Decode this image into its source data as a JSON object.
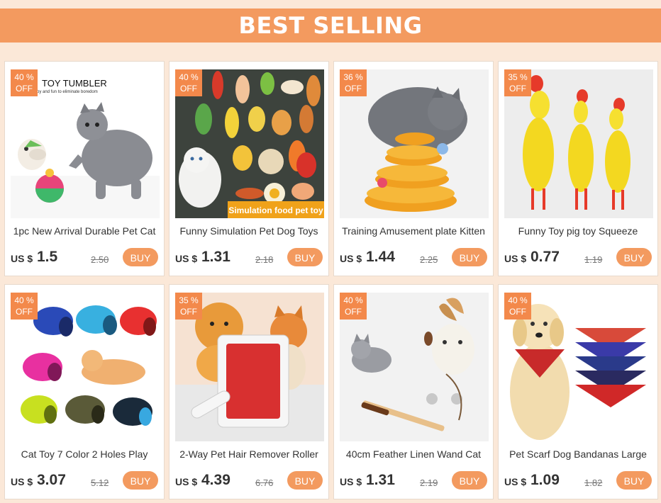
{
  "header": {
    "title": "BEST SELLING"
  },
  "products": [
    {
      "discount": "40 %",
      "off": "OFF",
      "title": "1pc New Arrival Durable Pet Cat",
      "currency": "US $",
      "price": "1.5",
      "old_price": "2.50",
      "buy_label": "BUY",
      "image_caption": "TOY TUMBLER",
      "image_subcaption": "Joy and fun to eliminate boredom"
    },
    {
      "discount": "40 %",
      "off": "OFF",
      "title": "Funny Simulation Pet Dog Toys",
      "currency": "US $",
      "price": "1.31",
      "old_price": "2.18",
      "buy_label": "BUY",
      "image_caption": "Simulation food pet toy"
    },
    {
      "discount": "36 %",
      "off": "OFF",
      "title": "Training Amusement plate Kitten",
      "currency": "US $",
      "price": "1.44",
      "old_price": "2.25",
      "buy_label": "BUY"
    },
    {
      "discount": "35 %",
      "off": "OFF",
      "title": "Funny Toy pig toy Squeeze",
      "currency": "US $",
      "price": "0.77",
      "old_price": "1.19",
      "buy_label": "BUY"
    },
    {
      "discount": "40 %",
      "off": "OFF",
      "title": "Cat Toy 7 Color 2 Holes Play",
      "currency": "US $",
      "price": "3.07",
      "old_price": "5.12",
      "buy_label": "BUY"
    },
    {
      "discount": "35 %",
      "off": "OFF",
      "title": "2-Way Pet Hair Remover Roller",
      "currency": "US $",
      "price": "4.39",
      "old_price": "6.76",
      "buy_label": "BUY"
    },
    {
      "discount": "40 %",
      "off": "OFF",
      "title": "40cm  Feather Linen Wand Cat",
      "currency": "US $",
      "price": "1.31",
      "old_price": "2.19",
      "buy_label": "BUY"
    },
    {
      "discount": "40 %",
      "off": "OFF",
      "title": "Pet Scarf Dog Bandanas Large",
      "currency": "US $",
      "price": "1.09",
      "old_price": "1.82",
      "buy_label": "BUY"
    }
  ],
  "colors": {
    "accent": "#f39a5f",
    "badge": "#f3894b",
    "background": "#fbe8d8"
  }
}
